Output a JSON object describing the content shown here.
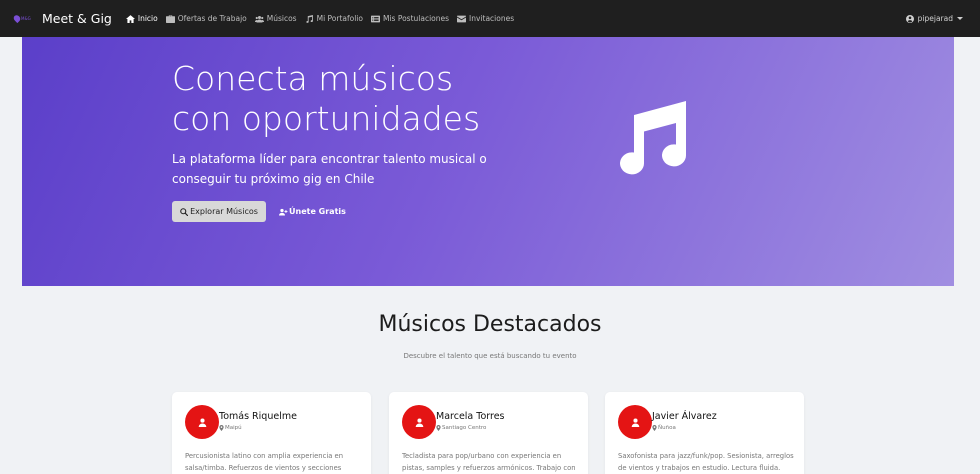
{
  "navbar": {
    "brand": "Meet & Gig",
    "items": [
      {
        "label": "Inicio",
        "icon": "home-icon",
        "active": true
      },
      {
        "label": "Ofertas de Trabajo",
        "icon": "briefcase-icon",
        "active": false
      },
      {
        "label": "Músicos",
        "icon": "users-icon",
        "active": false
      },
      {
        "label": "Mi Portafolio",
        "icon": "music-note-icon",
        "active": false
      },
      {
        "label": "Mis Postulaciones",
        "icon": "list-icon",
        "active": false
      },
      {
        "label": "Invitaciones",
        "icon": "envelope-icon",
        "active": false
      }
    ],
    "user": "pipejarad"
  },
  "hero": {
    "title": "Conecta músicos con oportunidades",
    "subtitle": "La plataforma líder para encontrar talento musical o conseguir tu próximo gig en Chile",
    "explore_label": "Explorar Músicos",
    "join_label": "Únete Gratis"
  },
  "section": {
    "title": "Músicos Destacados",
    "subtitle": "Descubre el talento que está buscando tu evento"
  },
  "cards": [
    {
      "name": "Tomás Riquelme",
      "location": "Maipú",
      "description": "Percusionista latino con amplia experiencia en salsa/timba. Refuerzos de vientos y secciones rítmicas"
    },
    {
      "name": "Marcela Torres",
      "location": "Santiago Centro",
      "description": "Tecladista para pop/urbano con experiencia en pistas, samples y refuerzos armónicos. Trabajo con"
    },
    {
      "name": "Javier Álvarez",
      "location": "Ñuñoa",
      "description": "Saxofonista para jazz/funk/pop. Sesionista, arreglos de vientos y trabajos en estudio. Lectura fluida."
    }
  ],
  "colors": {
    "navbar_bg": "#1f1f1f",
    "hero_gradient_start": "#5b3fc9",
    "hero_gradient_end": "#a08ee1",
    "avatar_bg": "#e41414",
    "page_bg": "#f0f2f5"
  }
}
